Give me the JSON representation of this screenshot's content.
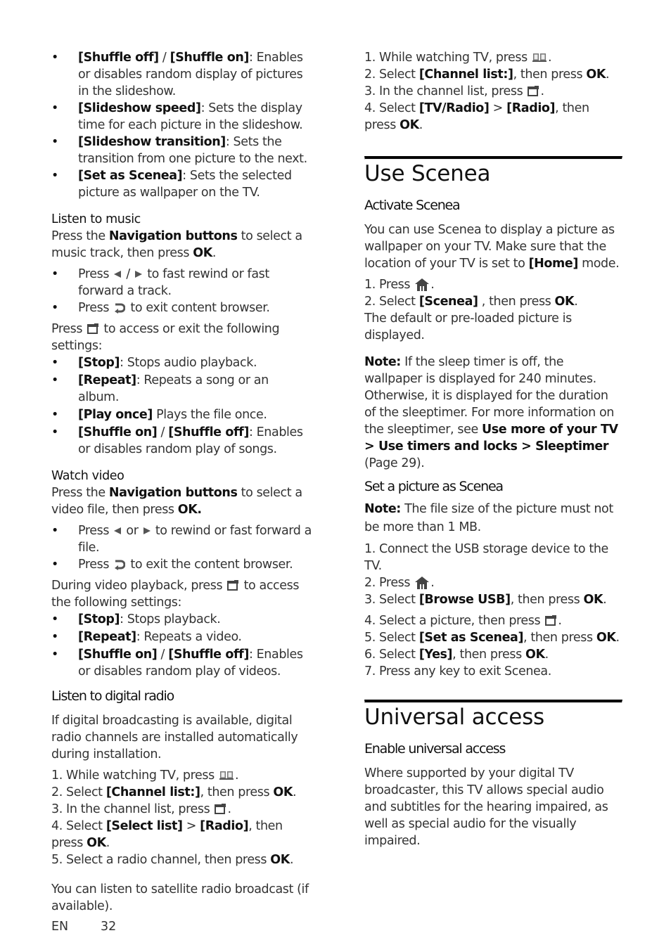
{
  "page": {
    "lang": "EN",
    "number": "32"
  },
  "left": {
    "slideshow_items": [
      {
        "b1": "[Shuffle off]",
        "sep": " / ",
        "b2": "[Shuffle on]",
        "text": ": Enables or disables random display of pictures in the slideshow."
      },
      {
        "b1": "[Slideshow speed]",
        "text": ": Sets the display time for each picture in the slideshow."
      },
      {
        "b1": "[Slideshow transition]",
        "text": ": Sets the transition from one picture to the next."
      },
      {
        "b1": "[Set as Scenea]",
        "text": ": Sets the selected picture as wallpaper on the TV."
      }
    ],
    "music": {
      "title": "Listen to music",
      "intro_a": "Press the ",
      "intro_b": "Navigation buttons",
      "intro_c": " to select a music track, then press ",
      "intro_d": "OK",
      "intro_e": ".",
      "bullet1_a": "Press ",
      "bullet1_sep": " / ",
      "bullet1_b": " to fast rewind or fast forward a track.",
      "bullet2_a": "Press ",
      "bullet2_b": " to exit content browser.",
      "settings_a": "Press ",
      "settings_b": " to access or exit the following settings:",
      "settings": [
        {
          "b1": "[Stop]",
          "text": ": Stops audio playback."
        },
        {
          "b1": "[Repeat]",
          "text": ": Repeats a song or an album."
        },
        {
          "b1": "[Play once]",
          "text": " Plays the file once."
        },
        {
          "b1": "[Shuffle on]",
          "sep": " / ",
          "b2": "[Shuffle off]",
          "text": ": Enables or disables random play of songs."
        }
      ]
    },
    "video": {
      "title": "Watch video",
      "intro_a": "Press the ",
      "intro_b": "Navigation buttons",
      "intro_c": " to select a video file, then press ",
      "intro_d": "OK.",
      "bullet1_a": "Press ",
      "bullet1_sep": " or ",
      "bullet1_b": " to rewind or fast forward a file.",
      "bullet2_a": "Press ",
      "bullet2_b": " to exit the content browser.",
      "settings_a": "During video playback, press ",
      "settings_b": " to access the following settings:",
      "settings": [
        {
          "b1": "[Stop]",
          "text": ": Stops playback."
        },
        {
          "b1": "[Repeat]",
          "text": ": Repeats a video."
        },
        {
          "b1": "[Shuffle on]",
          "sep": " / ",
          "b2": "[Shuffle off]",
          "text": ": Enables or disables random play of videos."
        }
      ]
    },
    "radio": {
      "title": "Listen to digital radio",
      "intro": "If digital broadcasting is available, digital radio channels are installed automatically during installation.",
      "step1": "1. While watching TV, press ",
      "step2_a": "2. Select ",
      "step2_b": "[Channel list:]",
      "step2_c": ", then press ",
      "step2_d": "OK",
      "step2_e": ".",
      "step3": "3. In the channel list, press ",
      "step4_a": "4. Select ",
      "step4_b": "[Select list]",
      "step4_c": " > ",
      "step4_d": "[Radio]",
      "step4_e": ", then press ",
      "step4_f": "OK",
      "step4_g": ".",
      "step5_a": "5. Select a radio channel, then press ",
      "step5_b": "OK",
      "step5_c": ".",
      "outro": "You can listen to satellite radio broadcast (if available)."
    }
  },
  "right": {
    "radio_cont": {
      "step1": "1. While watching TV, press ",
      "step2_a": "2. Select ",
      "step2_b": "[Channel list:]",
      "step2_c": ", then press ",
      "step2_d": "OK",
      "step2_e": ".",
      "step3": "3. In the channel list, press ",
      "step4_a": "4. Select ",
      "step4_b": "[TV/Radio]",
      "step4_c": " > ",
      "step4_d": "[Radio]",
      "step4_e": ", then press ",
      "step4_f": "OK",
      "step4_g": "."
    },
    "scenea": {
      "title": "Use Scenea",
      "activate_title": "Activate Scenea",
      "intro_a": "You can use Scenea to display a picture as wallpaper on your TV. Make sure that the location of your TV is set to ",
      "intro_b": "[Home]",
      "intro_c": " mode.",
      "step1": "1. Press ",
      "step2_a": "2. Select ",
      "step2_b": "[Scenea]",
      "step2_c": " , then press ",
      "step2_d": "OK",
      "step2_e": ".",
      "result": "The default or pre-loaded picture is displayed.",
      "note_label": "Note:",
      "note_text": " If the sleep timer is off, the wallpaper is displayed for 240 minutes. Otherwise, it is displayed for the duration of the sleeptimer. For more information on the sleeptimer, see ",
      "note_link": "Use more of your TV > Use timers and locks > Sleeptimer",
      "note_page": " (Page 29).",
      "set_title": "Set a picture as Scenea",
      "set_note_label": "Note:",
      "set_note_text": " The file size of the picture must not be more than 1 MB.",
      "s1": "1. Connect the USB storage device to the TV.",
      "s2": "2. Press ",
      "s3_a": "3. Select ",
      "s3_b": "[Browse USB]",
      "s3_c": ", then press ",
      "s3_d": "OK",
      "s3_e": ".",
      "s4": "4. Select a picture, then press ",
      "s5_a": "5. Select ",
      "s5_b": "[Set as Scenea]",
      "s5_c": ", then press ",
      "s5_d": "OK",
      "s5_e": ".",
      "s6_a": "6. Select ",
      "s6_b": "[Yes]",
      "s6_c": ", then press ",
      "s6_d": "OK",
      "s6_e": ".",
      "s7": "7. Press any key to exit Scenea."
    },
    "universal": {
      "title": "Universal access",
      "sub_title": "Enable universal access",
      "body": "Where supported by your digital TV broadcaster, this TV allows special audio and subtitles for the hearing impaired, as well as special audio for the visually impaired."
    }
  },
  "icons": {
    "rewind": "rewind-icon",
    "forward": "forward-icon",
    "back": "back-icon",
    "options": "options-icon",
    "guide": "guide-icon",
    "home": "home-icon"
  }
}
